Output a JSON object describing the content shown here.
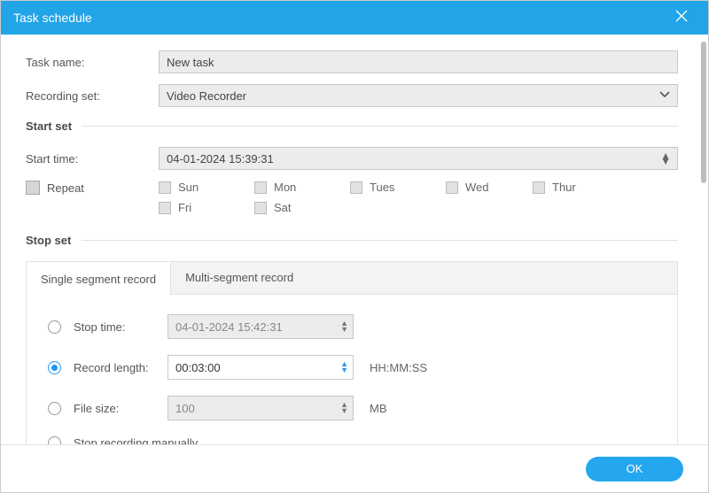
{
  "titlebar": {
    "title": "Task schedule"
  },
  "form": {
    "task_name_label": "Task name:",
    "task_name_value": "New task",
    "recording_set_label": "Recording set:",
    "recording_set_value": "Video Recorder"
  },
  "start_set": {
    "title": "Start set",
    "start_time_label": "Start time:",
    "start_time_value": "04-01-2024 15:39:31",
    "repeat_label": "Repeat",
    "days": [
      "Sun",
      "Mon",
      "Tues",
      "Wed",
      "Thur",
      "Fri",
      "Sat"
    ]
  },
  "stop_set": {
    "title": "Stop set",
    "tabs": {
      "single": "Single segment record",
      "multi": "Multi-segment record"
    },
    "stop_time_label": "Stop time:",
    "stop_time_value": "04-01-2024 15:42:31",
    "record_length_label": "Record length:",
    "record_length_value": "00:03:00",
    "record_length_unit": "HH:MM:SS",
    "file_size_label": "File size:",
    "file_size_value": "100",
    "file_size_unit": "MB",
    "manual_label": "Stop recording manually"
  },
  "footer": {
    "ok": "OK"
  }
}
